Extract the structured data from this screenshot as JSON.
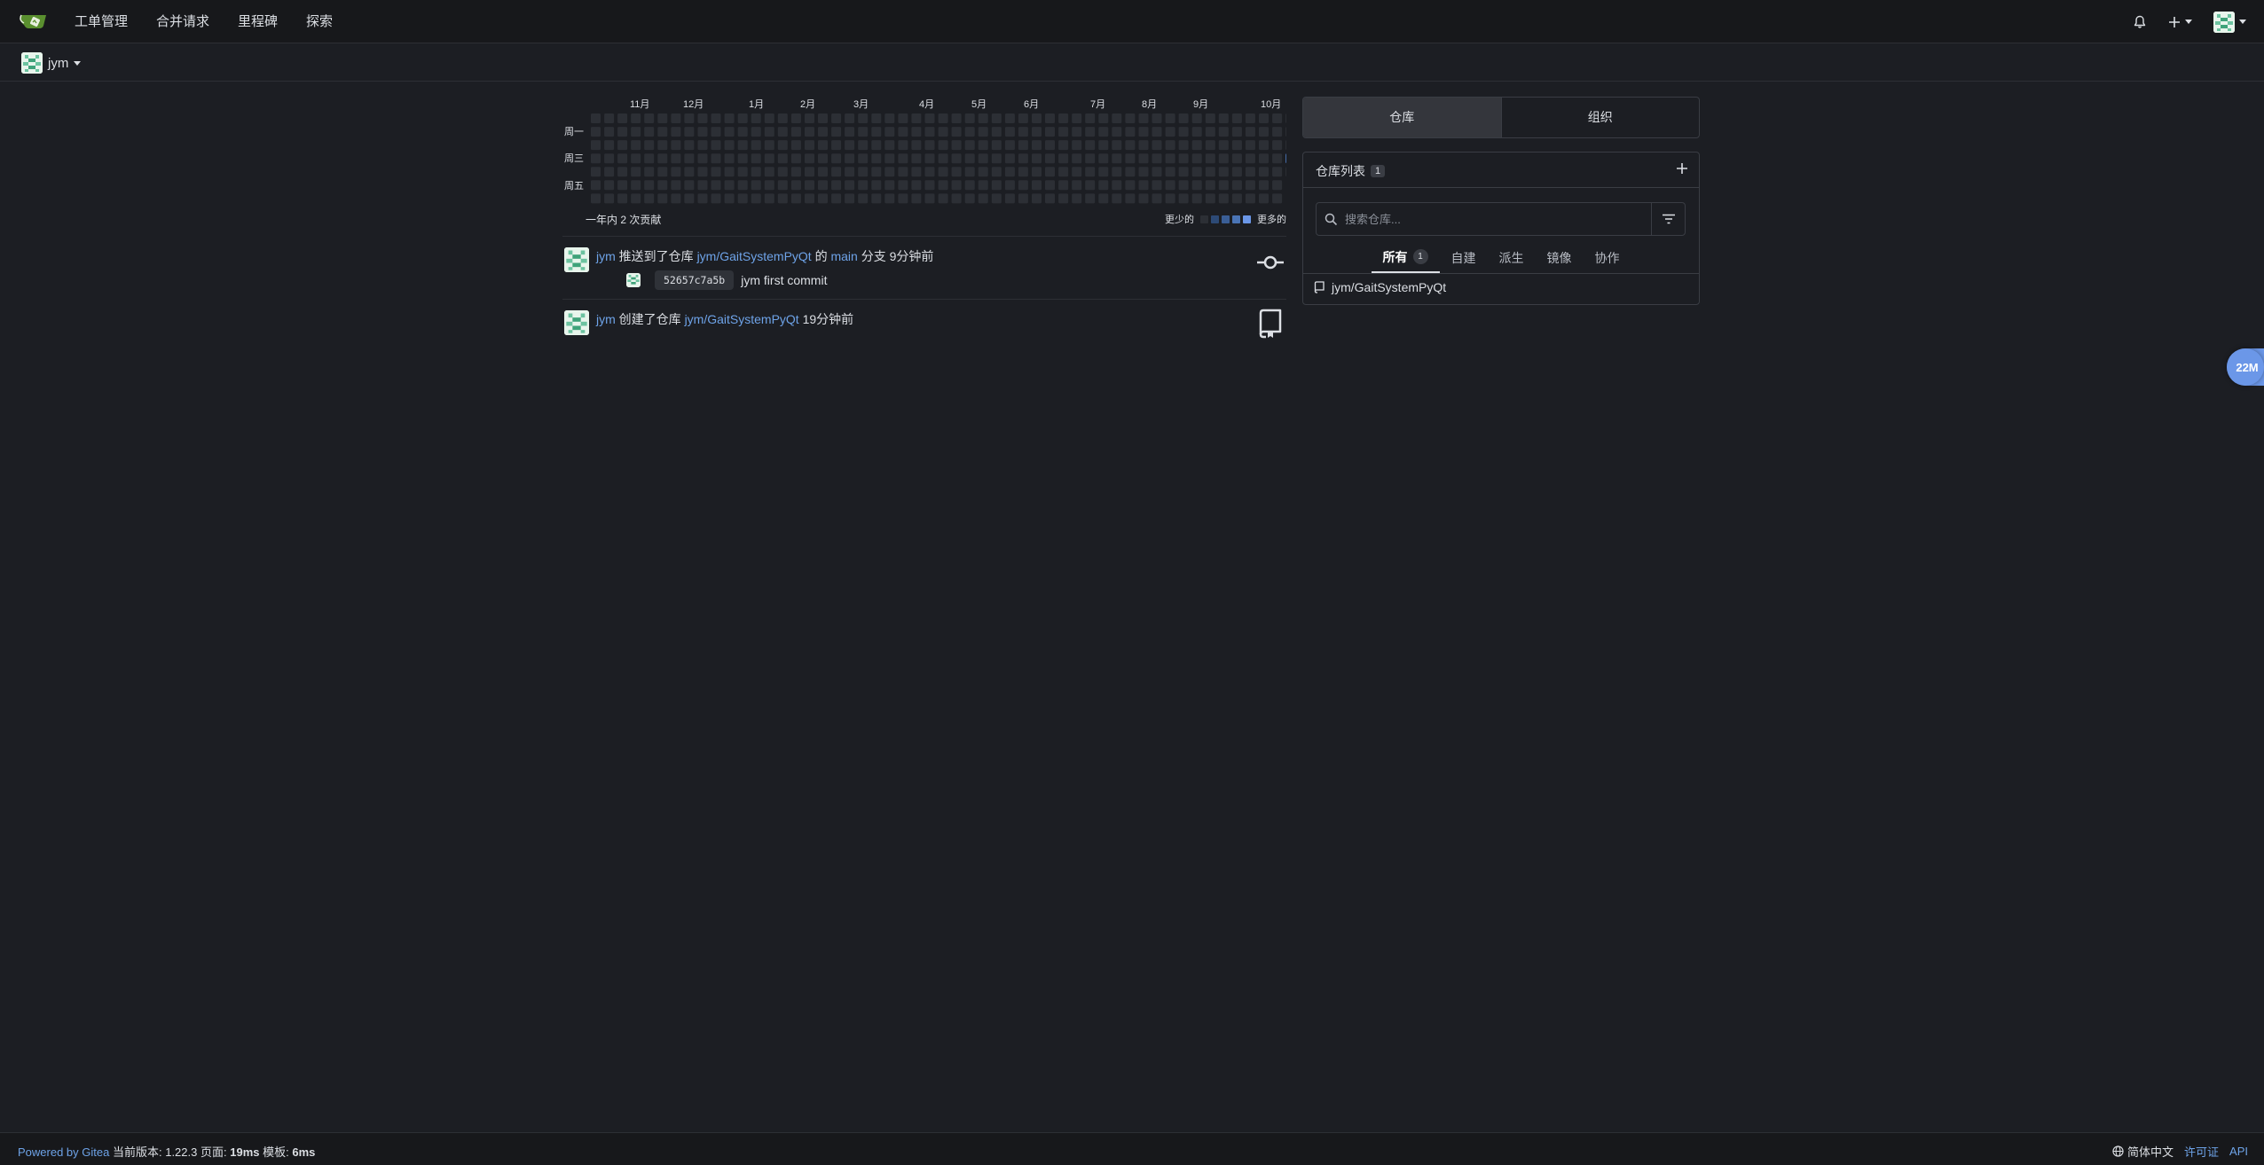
{
  "navbar": {
    "items": [
      "工单管理",
      "合并请求",
      "里程碑",
      "探索"
    ],
    "icons": [
      "gitea-logo-icon",
      "bell-icon",
      "plus-icon",
      "avatar"
    ]
  },
  "context": {
    "user": "jym"
  },
  "heatmap": {
    "months": [
      "11月",
      "12月",
      "1月",
      "2月",
      "3月",
      "4月",
      "5月",
      "6月",
      "7月",
      "8月",
      "9月",
      "10月"
    ],
    "days": [
      "周一",
      "周三",
      "周五"
    ],
    "summary": "一年内 2 次贡献",
    "legend_less": "更少的",
    "legend_more": "更多的",
    "colors": {
      "empty": "#2c2f35",
      "level1": "#2d4a76",
      "level2": "#3a5e96",
      "level3": "#4a74b5",
      "level4": "#6b97e8"
    },
    "active_cell": {
      "week_from_end": 0,
      "day": "周四",
      "level": 3
    }
  },
  "feed": {
    "push": {
      "user": "jym",
      "action": "推送到了仓库",
      "repo": "jym/GaitSystemPyQt",
      "of": "的",
      "branch": "main",
      "branch_suffix": "分支",
      "time": "9分钟前",
      "commit_sha": "52657c7a5b",
      "commit_msg": "jym first commit"
    },
    "create": {
      "user": "jym",
      "action": "创建了仓库",
      "repo": "jym/GaitSystemPyQt",
      "time": "19分钟前"
    }
  },
  "panel": {
    "tabs": [
      "仓库",
      "组织"
    ],
    "active_tab": "仓库",
    "repo_list_title": "仓库列表",
    "repo_count": "1",
    "search_placeholder": "搜索仓库...",
    "filters": [
      {
        "label": "所有",
        "count": "1",
        "active": true
      },
      {
        "label": "自建"
      },
      {
        "label": "派生"
      },
      {
        "label": "镜像"
      },
      {
        "label": "协作"
      }
    ],
    "repos": [
      "jym/GaitSystemPyQt"
    ]
  },
  "float_badge": "22M",
  "footer": {
    "powered": "Powered by Gitea",
    "version_label": "当前版本:",
    "version": "1.22.3",
    "page_label": "页面:",
    "page_time": "19ms",
    "tmpl_label": "模板:",
    "tmpl_time": "6ms",
    "language": "简体中文",
    "license": "许可证",
    "api": "API"
  }
}
